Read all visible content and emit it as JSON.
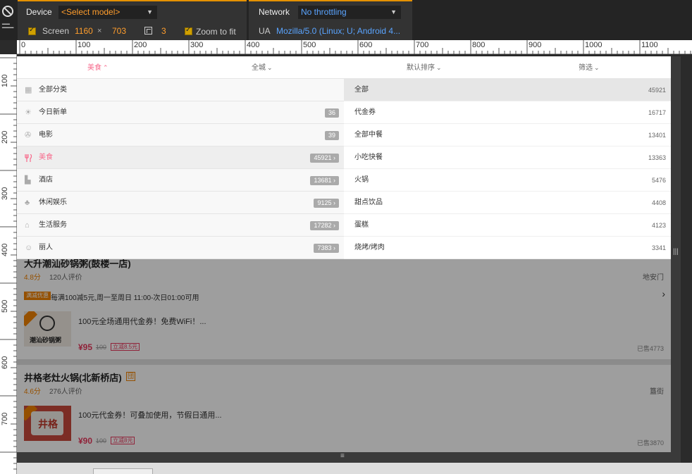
{
  "devtools": {
    "device_label": "Device",
    "device_model": "<Select model>",
    "network_label": "Network",
    "network_value": "No throttling",
    "screen_label": "Screen",
    "screen_width": "1160",
    "screen_times": "×",
    "screen_height": "703",
    "dpr": "3",
    "zoom_label": "Zoom to fit",
    "ua_label": "UA",
    "ua_value": "Mozilla/5.0 (Linux; U; Android 4..."
  },
  "ruler": {
    "h": [
      "0",
      "100",
      "200",
      "300",
      "400",
      "500",
      "600",
      "700",
      "800",
      "900",
      "1000",
      "1100"
    ],
    "v": [
      "100",
      "200",
      "300",
      "400",
      "500",
      "600",
      "700"
    ]
  },
  "tabs": [
    {
      "label": "美食",
      "chevron": "⌃"
    },
    {
      "label": "全城",
      "chevron": "⌄"
    },
    {
      "label": "默认排序",
      "chevron": "⌄"
    },
    {
      "label": "筛选",
      "chevron": "⌄"
    }
  ],
  "categories": [
    {
      "icon": "grid-icon",
      "glyph": "▦",
      "name": "全部分类",
      "count": ""
    },
    {
      "icon": "sun-icon",
      "glyph": "☀",
      "name": "今日新单",
      "count": "36"
    },
    {
      "icon": "film-icon",
      "glyph": "✇",
      "name": "电影",
      "count": "39"
    },
    {
      "icon": "fork-knife-icon",
      "glyph": "🍴",
      "name": "美食",
      "count": "45921 ›"
    },
    {
      "icon": "hotel-icon",
      "glyph": "▙",
      "name": "酒店",
      "count": "13681 ›"
    },
    {
      "icon": "leisure-icon",
      "glyph": "♣",
      "name": "休闲娱乐",
      "count": "9125 ›"
    },
    {
      "icon": "home-icon",
      "glyph": "⌂",
      "name": "生活服务",
      "count": "17282 ›"
    },
    {
      "icon": "person-icon",
      "glyph": "☺",
      "name": "丽人",
      "count": "7383 ›"
    }
  ],
  "subcategories": [
    {
      "name": "全部",
      "count": "45921"
    },
    {
      "name": "代金券",
      "count": "16717"
    },
    {
      "name": "全部中餐",
      "count": "13401"
    },
    {
      "name": "小吃快餐",
      "count": "13363"
    },
    {
      "name": "火锅",
      "count": "5476"
    },
    {
      "name": "甜点饮品",
      "count": "4408"
    },
    {
      "name": "蛋糕",
      "count": "4123"
    },
    {
      "name": "烧烤/烤肉",
      "count": "3341"
    }
  ],
  "shops": [
    {
      "title": "大升潮汕砂锅粥(鼓楼一店)",
      "rating": "4.8分",
      "reviews": "120人评价",
      "area": "地安门",
      "promo_tag": "满减优惠",
      "promo_text": "每满100减5元,周一至周日 11:00-次日01:00可用",
      "promo_chevron": "›",
      "thumb_text": "潮汕砂锅粥",
      "deal": "100元全场通用代金券！免费WiFi！...",
      "price": "¥95",
      "old_price": "100",
      "save": "立减8.5元",
      "sold": "已售4773"
    },
    {
      "title": "井格老灶火锅(北新桥店)",
      "badge": "団",
      "rating": "4.6分",
      "reviews": "276人评价",
      "area": "簋街",
      "thumb_text": "井格",
      "deal": "100元代金券！可叠加使用，节假日通用...",
      "price": "¥90",
      "old_price": "100",
      "save": "立减8元",
      "sold": "已售3870"
    }
  ],
  "handles": {
    "bottom": "≡",
    "right": "|||"
  }
}
